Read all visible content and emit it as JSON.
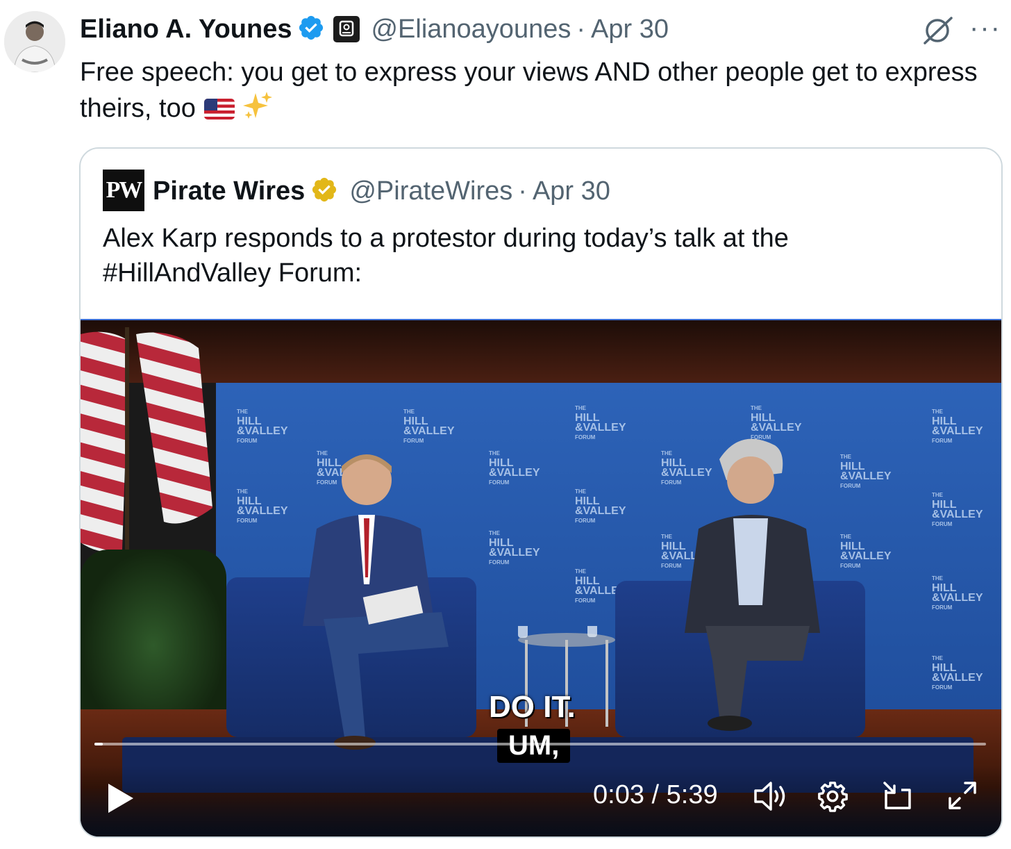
{
  "tweet": {
    "author_name": "Eliano A. Younes",
    "handle": "@Elianoayounes",
    "separator": "·",
    "date": "Apr 30",
    "text": "Free speech: you get to express your views AND other people get to express theirs, too",
    "more_label": "···"
  },
  "quoted": {
    "logo_text": "PW",
    "author_name": "Pirate Wires",
    "handle": "@PirateWires",
    "separator": "·",
    "date": "Apr 30",
    "text": "Alex Karp responds to a protestor during today’s talk at the #HillAndValley Forum:"
  },
  "video": {
    "backdrop_logo": "THE HILL &VALLEY FORUM",
    "caption_line1": "DO IT.",
    "caption_line2": "UM,",
    "current_time": "0:03",
    "duration": "5:39",
    "time_display": "0:03 / 5:39",
    "progress": 0.009
  },
  "colors": {
    "verified_blue": "#1d9bf0",
    "gold_badge": "#e2b719",
    "muted_text": "#536471",
    "border": "#cfd9de"
  },
  "icons": [
    "verified-badge-icon",
    "account-label-icon",
    "grok-icon",
    "more-icon",
    "gold-verified-badge-icon",
    "flag-emoji-icon",
    "sparkles-emoji-icon",
    "play-icon",
    "volume-icon",
    "settings-icon",
    "pip-icon",
    "fullscreen-icon"
  ]
}
